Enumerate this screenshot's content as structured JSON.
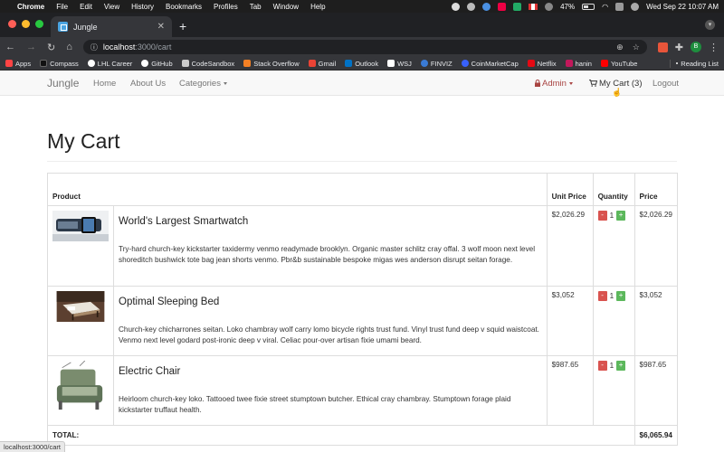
{
  "menubar": {
    "items": [
      "Chrome",
      "File",
      "Edit",
      "View",
      "History",
      "Bookmarks",
      "Profiles",
      "Tab",
      "Window",
      "Help"
    ],
    "battery": "47%",
    "datetime": "Wed Sep 22  10:07 AM"
  },
  "browser": {
    "tab_title": "Jungle",
    "url_host": "localhost",
    "url_path": ":3000/cart",
    "profile_initial": "B",
    "bookmarks": [
      "Apps",
      "Compass",
      "LHL Career",
      "GitHub",
      "CodeSandbox",
      "Stack Overflow",
      "Gmail",
      "Outlook",
      "WSJ",
      "FINVIZ",
      "CoinMarketCap",
      "Netflix",
      "hanin",
      "YouTube"
    ],
    "reading_list": "Reading List",
    "status_url": "localhost:3000/cart"
  },
  "navbar": {
    "brand": "Jungle",
    "home": "Home",
    "about": "About Us",
    "categories": "Categories",
    "admin": "Admin",
    "cart": "My Cart (3)",
    "logout": "Logout"
  },
  "page": {
    "title": "My Cart"
  },
  "table": {
    "headers": {
      "product": "Product",
      "unit_price": "Unit Price",
      "quantity": "Quantity",
      "price": "Price"
    },
    "rows": [
      {
        "name": "World's Largest Smartwatch",
        "description": "Try-hard church-key kickstarter taxidermy venmo readymade brooklyn. Organic master schlitz cray offal. 3 wolf moon next level shoreditch bushwick tote bag jean shorts venmo. Pbr&b sustainable bespoke migas wes anderson disrupt seitan forage.",
        "unit_price": "$2,026.29",
        "quantity": "1",
        "price": "$2,026.29"
      },
      {
        "name": "Optimal Sleeping Bed",
        "description": "Church-key chicharrones seitan. Loko chambray wolf carry lomo bicycle rights trust fund. Vinyl trust fund deep v squid waistcoat. Venmo next level godard post-ironic deep v viral. Celiac pour-over artisan fixie umami beard.",
        "unit_price": "$3,052",
        "quantity": "1",
        "price": "$3,052"
      },
      {
        "name": "Electric Chair",
        "description": "Heirloom church-key loko. Tattooed twee fixie street stumptown butcher. Ethical cray chambray. Stumptown forage plaid kickstarter truffaut health.",
        "unit_price": "$987.65",
        "quantity": "1",
        "price": "$987.65"
      }
    ],
    "total_label": "TOTAL:",
    "total_value": "$6,065.94",
    "minus_label": "-",
    "plus_label": "+"
  },
  "colors": {
    "danger": "#d9534f",
    "success": "#5cb85c",
    "admin": "#a94442"
  }
}
